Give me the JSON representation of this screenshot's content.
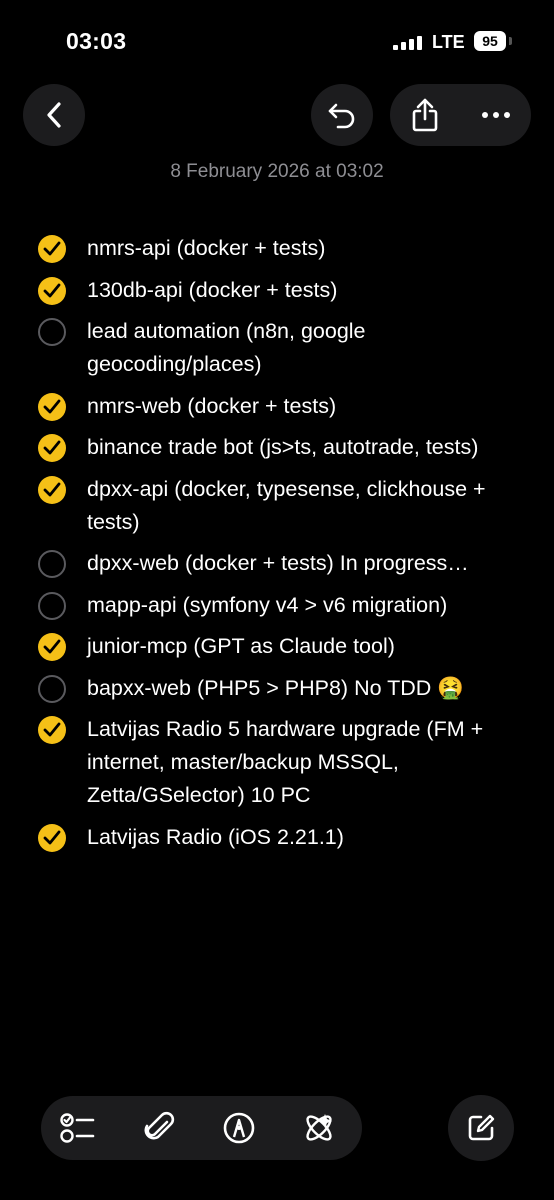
{
  "status_bar": {
    "time": "03:03",
    "network": "LTE",
    "battery": "95"
  },
  "toolbar": {
    "back_icon": "chevron-left-icon",
    "undo_icon": "undo-icon",
    "share_icon": "share-icon",
    "more_icon": "ellipsis-icon"
  },
  "note": {
    "date": "8 February 2026 at 03:02",
    "items": [
      {
        "text": "nmrs-api (docker + tests)",
        "checked": true
      },
      {
        "text": "130db-api (docker + tests)",
        "checked": true
      },
      {
        "text": "lead automation (n8n, google geocoding/places)",
        "checked": false
      },
      {
        "text": "nmrs-web (docker + tests)",
        "checked": true
      },
      {
        "text": "binance trade bot (js>ts, autotrade, tests)",
        "checked": true
      },
      {
        "text": "dpxx-api (docker, typesense, clickhouse + tests)",
        "checked": true
      },
      {
        "text": "dpxx-web (docker + tests) In progress…",
        "checked": false
      },
      {
        "text": "mapp-api (symfony v4 > v6 migration)",
        "checked": false
      },
      {
        "text": "junior-mcp (GPT as Claude tool)",
        "checked": true
      },
      {
        "text": "bapxx-web (PHP5 > PHP8) No TDD 🤮",
        "checked": false
      },
      {
        "text": "Latvijas Radio 5 hardware upgrade (FM + internet, master/backup MSSQL, Zetta/GSelector) 10 PC",
        "checked": true
      },
      {
        "text": "Latvijas Radio (iOS 2.21.1)",
        "checked": true
      }
    ]
  },
  "bottom_toolbar": {
    "icons": [
      "checklist-icon",
      "paperclip-icon",
      "markup-pen-icon",
      "writing-tools-icon"
    ],
    "compose_icon": "compose-icon"
  },
  "colors": {
    "accent": "#f5c017",
    "background": "#000000",
    "button_bg": "#1c1c1e",
    "secondary_text": "#8e8e93"
  }
}
